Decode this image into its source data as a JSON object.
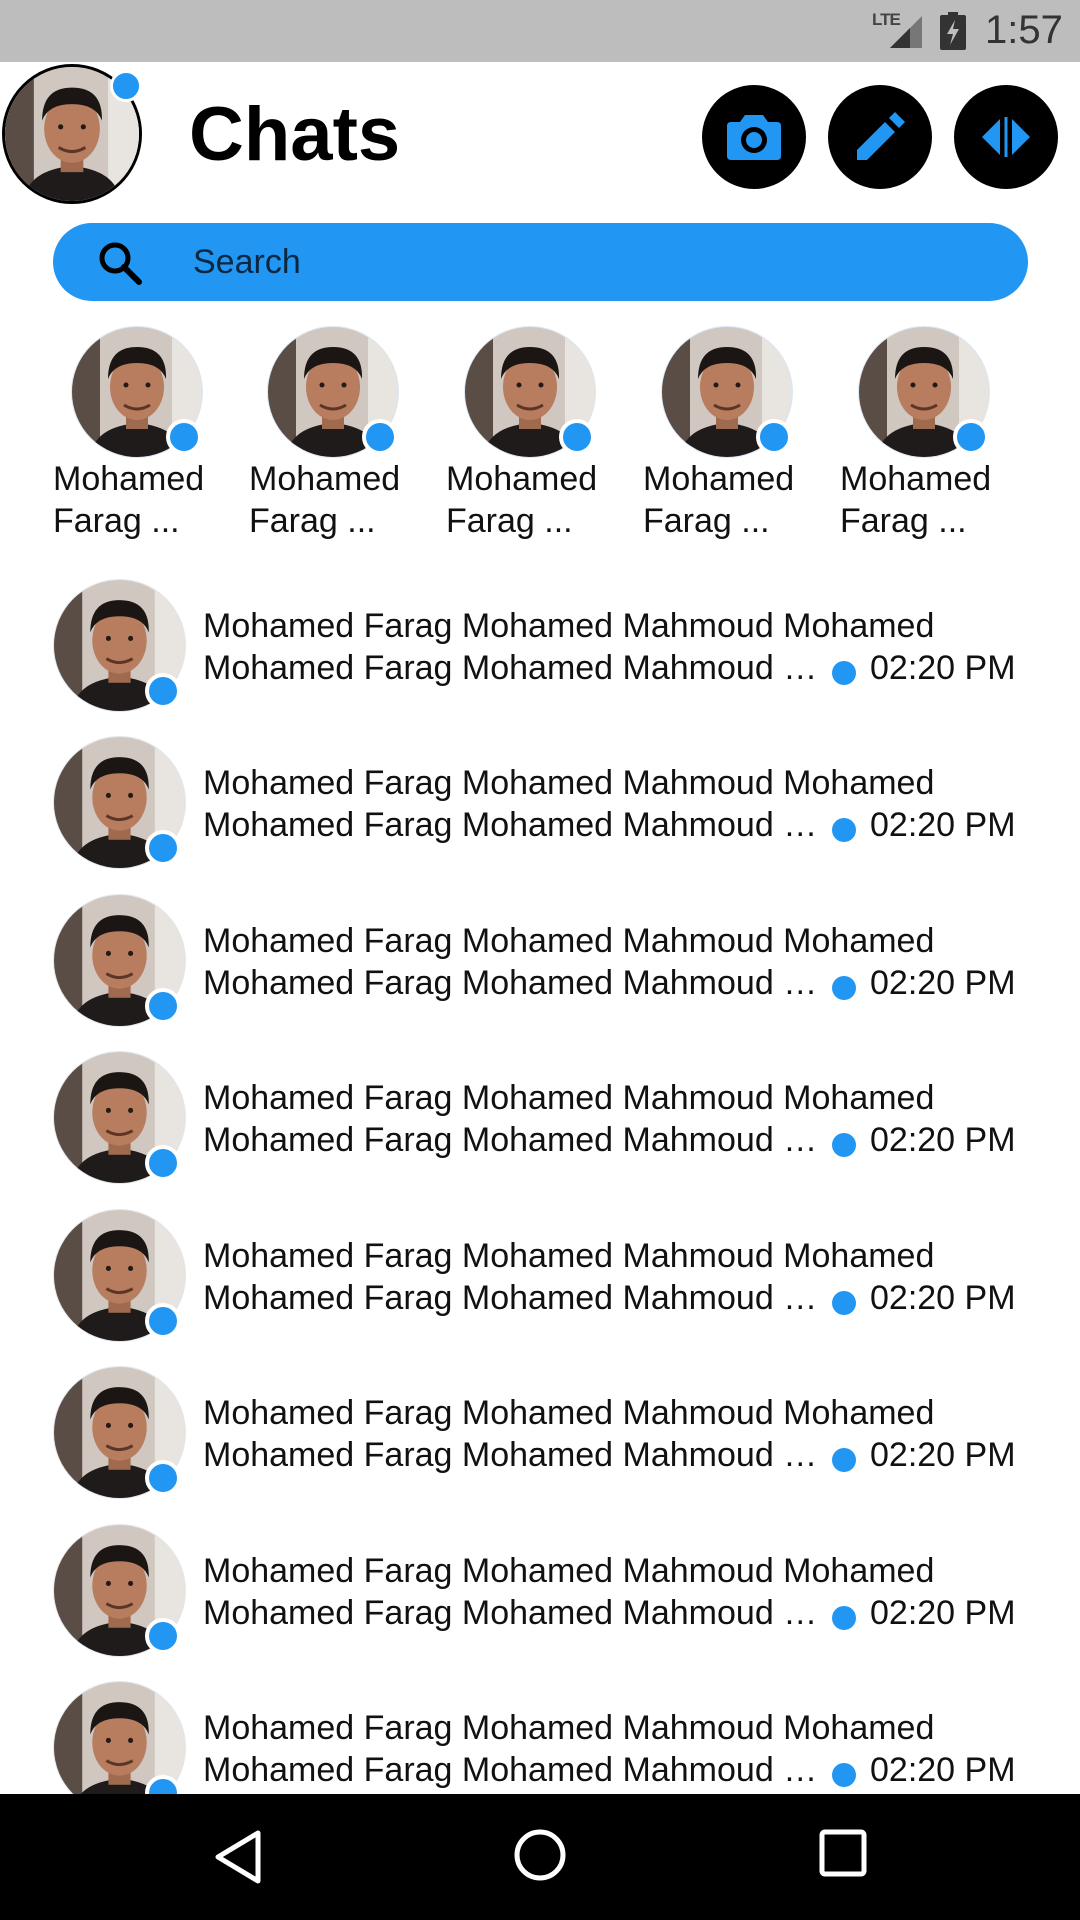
{
  "status_bar": {
    "network": "LTE",
    "time": "1:57"
  },
  "header": {
    "title": "Chats",
    "buttons": [
      "camera-icon",
      "pencil-icon",
      "code-icon"
    ]
  },
  "search": {
    "placeholder": "Search"
  },
  "stories": [
    {
      "name": "Mohamed Farag ..."
    },
    {
      "name": "Mohamed Farag ..."
    },
    {
      "name": "Mohamed Farag ..."
    },
    {
      "name": "Mohamed Farag ..."
    },
    {
      "name": "Mohamed Farag ..."
    }
  ],
  "chats": [
    {
      "name": "Mohamed Farag Mohamed Mahmoud Mohamed",
      "message": "Mohamed Farag Mohamed Mahmoud Mohamed",
      "time": "02:20 PM"
    },
    {
      "name": "Mohamed Farag Mohamed Mahmoud Mohamed",
      "message": "Mohamed Farag Mohamed Mahmoud Mohamed",
      "time": "02:20 PM"
    },
    {
      "name": "Mohamed Farag Mohamed Mahmoud Mohamed",
      "message": "Mohamed Farag Mohamed Mahmoud Mohamed",
      "time": "02:20 PM"
    },
    {
      "name": "Mohamed Farag Mohamed Mahmoud Mohamed",
      "message": "Mohamed Farag Mohamed Mahmoud Mohamed",
      "time": "02:20 PM"
    },
    {
      "name": "Mohamed Farag Mohamed Mahmoud Mohamed",
      "message": "Mohamed Farag Mohamed Mahmoud Mohamed",
      "time": "02:20 PM"
    },
    {
      "name": "Mohamed Farag Mohamed Mahmoud Mohamed",
      "message": "Mohamed Farag Mohamed Mahmoud Mohamed",
      "time": "02:20 PM"
    },
    {
      "name": "Mohamed Farag Mohamed Mahmoud Mohamed",
      "message": "Mohamed Farag Mohamed Mahmoud Mohamed",
      "time": "02:20 PM"
    },
    {
      "name": "Mohamed Farag Mohamed Mahmoud Mohamed",
      "message": "Mohamed Farag Mohamed Mahmoud Mohamed",
      "time": "02:20 PM"
    }
  ],
  "nav": [
    "back-icon",
    "home-icon",
    "recents-icon"
  ],
  "colors": {
    "accent": "#2196f3",
    "status_bar": "#bdbdbd",
    "nav_bar": "#000000",
    "header_buttons": "#000000"
  }
}
